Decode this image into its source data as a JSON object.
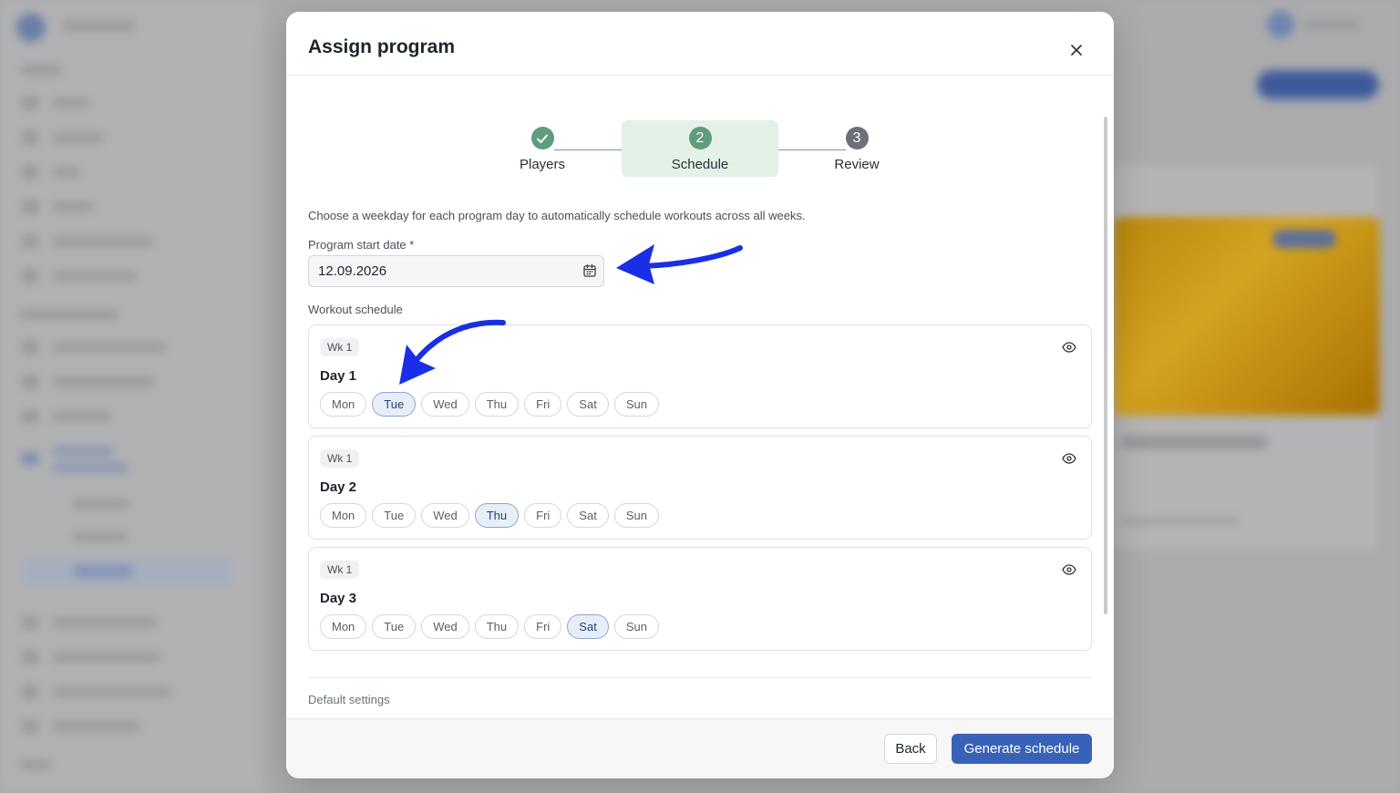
{
  "modal": {
    "title": "Assign program",
    "close_icon": "close-icon"
  },
  "stepper": {
    "steps": [
      {
        "number": "1",
        "label": "Players",
        "state": "done"
      },
      {
        "number": "2",
        "label": "Schedule",
        "state": "current"
      },
      {
        "number": "3",
        "label": "Review",
        "state": "pending"
      }
    ]
  },
  "intro_text": "Choose a weekday for each program day to automatically schedule workouts across all weeks.",
  "start_date": {
    "label": "Program start date *",
    "value": "12.09.2026",
    "icon": "calendar-icon"
  },
  "schedule": {
    "label": "Workout schedule",
    "weekdays": [
      "Mon",
      "Tue",
      "Wed",
      "Thu",
      "Fri",
      "Sat",
      "Sun"
    ],
    "days": [
      {
        "week_badge": "Wk 1",
        "title": "Day 1",
        "selected": "Tue"
      },
      {
        "week_badge": "Wk 1",
        "title": "Day 2",
        "selected": "Thu"
      },
      {
        "week_badge": "Wk 1",
        "title": "Day 3",
        "selected": "Sat"
      }
    ]
  },
  "default_settings_label": "Default settings",
  "footer": {
    "back_label": "Back",
    "generate_label": "Generate schedule"
  },
  "colors": {
    "primary": "#3862b7",
    "step_green": "#5e9c7c",
    "step_active_bg": "#e3f1e6",
    "annotation_arrow": "#1a2ee6"
  }
}
